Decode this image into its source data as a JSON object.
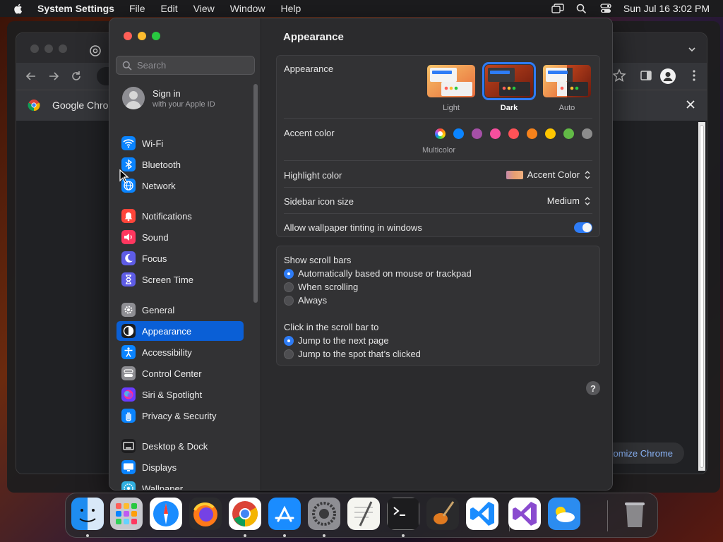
{
  "menubar": {
    "app_name": "System Settings",
    "menus": [
      "File",
      "Edit",
      "View",
      "Window",
      "Help"
    ],
    "clock": "Sun Jul 16  3:02 PM"
  },
  "chrome": {
    "infobar_text": "Google Chrom",
    "customize_label": "tomize Chrome"
  },
  "settings": {
    "search_placeholder": "Search",
    "signin": {
      "title": "Sign in",
      "subtitle": "with your Apple ID"
    },
    "sidebar_items": [
      {
        "label": "Wi-Fi",
        "icon": "wifi-icon",
        "color": "#0a84ff"
      },
      {
        "label": "Bluetooth",
        "icon": "bluetooth-icon",
        "color": "#0a84ff"
      },
      {
        "label": "Network",
        "icon": "network-globe-icon",
        "color": "#0a84ff"
      },
      {
        "label": "Notifications",
        "icon": "bell-icon",
        "color": "#ff453a"
      },
      {
        "label": "Sound",
        "icon": "speaker-icon",
        "color": "#ff375f"
      },
      {
        "label": "Focus",
        "icon": "moon-icon",
        "color": "#5e5ce6"
      },
      {
        "label": "Screen Time",
        "icon": "hourglass-icon",
        "color": "#5e5ce6"
      },
      {
        "label": "General",
        "icon": "gear-icon",
        "color": "#8e8e93"
      },
      {
        "label": "Appearance",
        "icon": "appearance-icon",
        "color": "#1c1c1e"
      },
      {
        "label": "Accessibility",
        "icon": "accessibility-icon",
        "color": "#0a84ff"
      },
      {
        "label": "Control Center",
        "icon": "control-center-icon",
        "color": "#8e8e93"
      },
      {
        "label": "Siri & Spotlight",
        "icon": "siri-icon",
        "color": "#6a3cff"
      },
      {
        "label": "Privacy & Security",
        "icon": "hand-icon",
        "color": "#0a84ff"
      },
      {
        "label": "Desktop & Dock",
        "icon": "desktop-dock-icon",
        "color": "#1c1c1e"
      },
      {
        "label": "Displays",
        "icon": "displays-icon",
        "color": "#0a84ff"
      },
      {
        "label": "Wallpaper",
        "icon": "wallpaper-icon",
        "color": "#30b0e0"
      }
    ],
    "active_item": "Appearance"
  },
  "appearance": {
    "title": "Appearance",
    "appearance_label": "Appearance",
    "modes": [
      "Light",
      "Dark",
      "Auto"
    ],
    "selected_mode": "Dark",
    "accent_label": "Accent color",
    "accent_colors": [
      "multicolor",
      "#0a84ff",
      "#a550a7",
      "#f74f9e",
      "#ff5257",
      "#f7821b",
      "#ffc600",
      "#62ba46",
      "#8c8c8c"
    ],
    "accent_selected_label": "Multicolor",
    "highlight_label": "Highlight color",
    "highlight_value": "Accent Color",
    "icon_size_label": "Sidebar icon size",
    "icon_size_value": "Medium",
    "tinting_label": "Allow wallpaper tinting in windows",
    "tinting_on": true,
    "scroll_bars_label": "Show scroll bars",
    "scroll_bar_options": [
      "Automatically based on mouse or trackpad",
      "When scrolling",
      "Always"
    ],
    "scroll_bar_selected": 0,
    "click_label": "Click in the scroll bar to",
    "click_options": [
      "Jump to the next page",
      "Jump to the spot that’s clicked"
    ],
    "click_selected": 0,
    "help": "?"
  },
  "dock": {
    "apps": [
      "Finder",
      "Launchpad",
      "Safari",
      "Firefox",
      "Google Chrome",
      "App Store",
      "System Settings",
      "TextEdit",
      "Terminal",
      "GarageBand",
      "Visual Studio Code",
      "Visual Studio",
      "Weather",
      "Trash"
    ]
  }
}
